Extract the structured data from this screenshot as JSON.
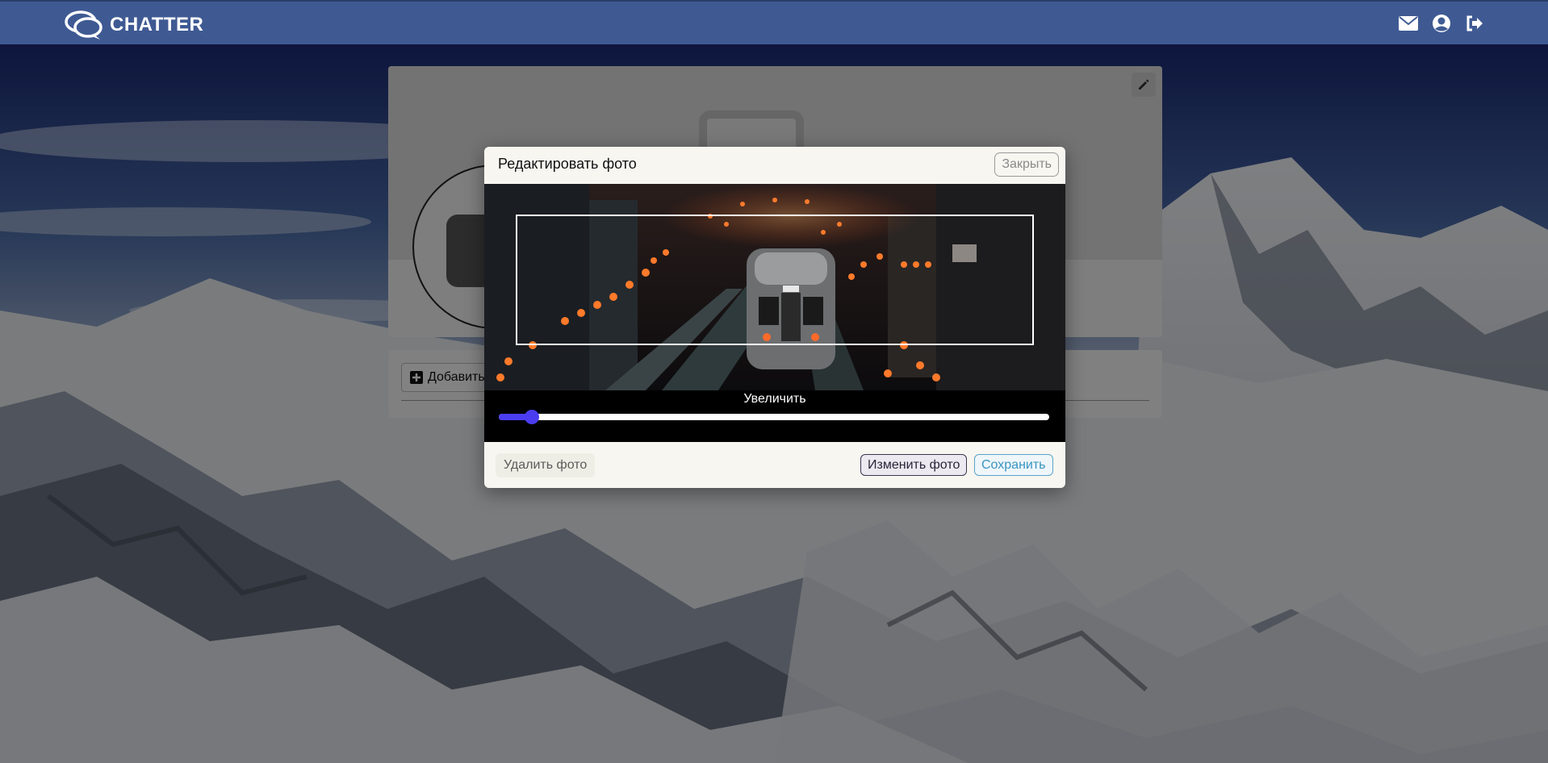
{
  "navbar": {
    "brand_name": "CHATTER",
    "icons": [
      "chat-bubbles-icon",
      "envelope-icon",
      "user-circle-icon",
      "sign-out-icon"
    ]
  },
  "profile": {
    "add_button_label": "Добавить"
  },
  "modal": {
    "title": "Редактировать фото",
    "close_label": "Закрыть",
    "zoom_label": "Увеличить",
    "zoom_level": 0.06,
    "delete_label": "Удалить фото",
    "change_label": "Изменить фото",
    "save_label": "Сохранить"
  },
  "colors": {
    "navbar": "#3f5a93",
    "slider_accent": "#4a3df0",
    "save_accent": "#3b94c0"
  }
}
